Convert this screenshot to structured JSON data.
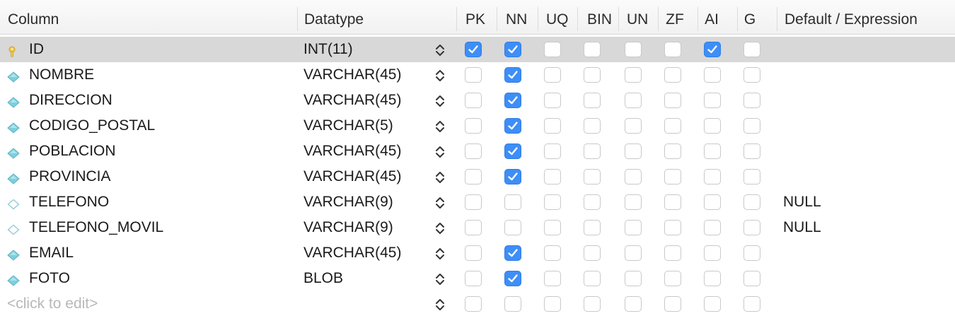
{
  "headers": {
    "column": "Column",
    "datatype": "Datatype",
    "flags": [
      "PK",
      "NN",
      "UQ",
      "BIN",
      "UN",
      "ZF",
      "AI",
      "G"
    ],
    "default": "Default / Expression"
  },
  "rows": [
    {
      "name": "ID",
      "type": "INT(11)",
      "icon": "primary-key-icon",
      "flags": [
        true,
        true,
        false,
        false,
        false,
        false,
        true,
        false
      ],
      "default": "",
      "selected": true
    },
    {
      "name": "NOMBRE",
      "type": "VARCHAR(45)",
      "icon": "filled-diamond-icon",
      "flags": [
        false,
        true,
        false,
        false,
        false,
        false,
        false,
        false
      ],
      "default": ""
    },
    {
      "name": "DIRECCION",
      "type": "VARCHAR(45)",
      "icon": "filled-diamond-icon",
      "flags": [
        false,
        true,
        false,
        false,
        false,
        false,
        false,
        false
      ],
      "default": ""
    },
    {
      "name": "CODIGO_POSTAL",
      "type": "VARCHAR(5)",
      "icon": "filled-diamond-icon",
      "flags": [
        false,
        true,
        false,
        false,
        false,
        false,
        false,
        false
      ],
      "default": ""
    },
    {
      "name": "POBLACION",
      "type": "VARCHAR(45)",
      "icon": "filled-diamond-icon",
      "flags": [
        false,
        true,
        false,
        false,
        false,
        false,
        false,
        false
      ],
      "default": ""
    },
    {
      "name": "PROVINCIA",
      "type": "VARCHAR(45)",
      "icon": "filled-diamond-icon",
      "flags": [
        false,
        true,
        false,
        false,
        false,
        false,
        false,
        false
      ],
      "default": ""
    },
    {
      "name": "TELEFONO",
      "type": "VARCHAR(9)",
      "icon": "hollow-diamond-icon",
      "flags": [
        false,
        false,
        false,
        false,
        false,
        false,
        false,
        false
      ],
      "default": "NULL"
    },
    {
      "name": "TELEFONO_MOVIL",
      "type": "VARCHAR(9)",
      "icon": "hollow-diamond-icon",
      "flags": [
        false,
        false,
        false,
        false,
        false,
        false,
        false,
        false
      ],
      "default": "NULL"
    },
    {
      "name": "EMAIL",
      "type": "VARCHAR(45)",
      "icon": "filled-diamond-icon",
      "flags": [
        false,
        true,
        false,
        false,
        false,
        false,
        false,
        false
      ],
      "default": ""
    },
    {
      "name": "FOTO",
      "type": "BLOB",
      "icon": "filled-diamond-icon",
      "flags": [
        false,
        true,
        false,
        false,
        false,
        false,
        false,
        false
      ],
      "default": ""
    }
  ],
  "new_row": {
    "placeholder": "<click to edit>",
    "flags": [
      false,
      false,
      false,
      false,
      false,
      false,
      false,
      false
    ]
  },
  "colors": {
    "checked": "#3d8ef7",
    "selected_row": "#d8d8d8",
    "diamond": "#7ecfdc",
    "key": "#f2c94c"
  }
}
